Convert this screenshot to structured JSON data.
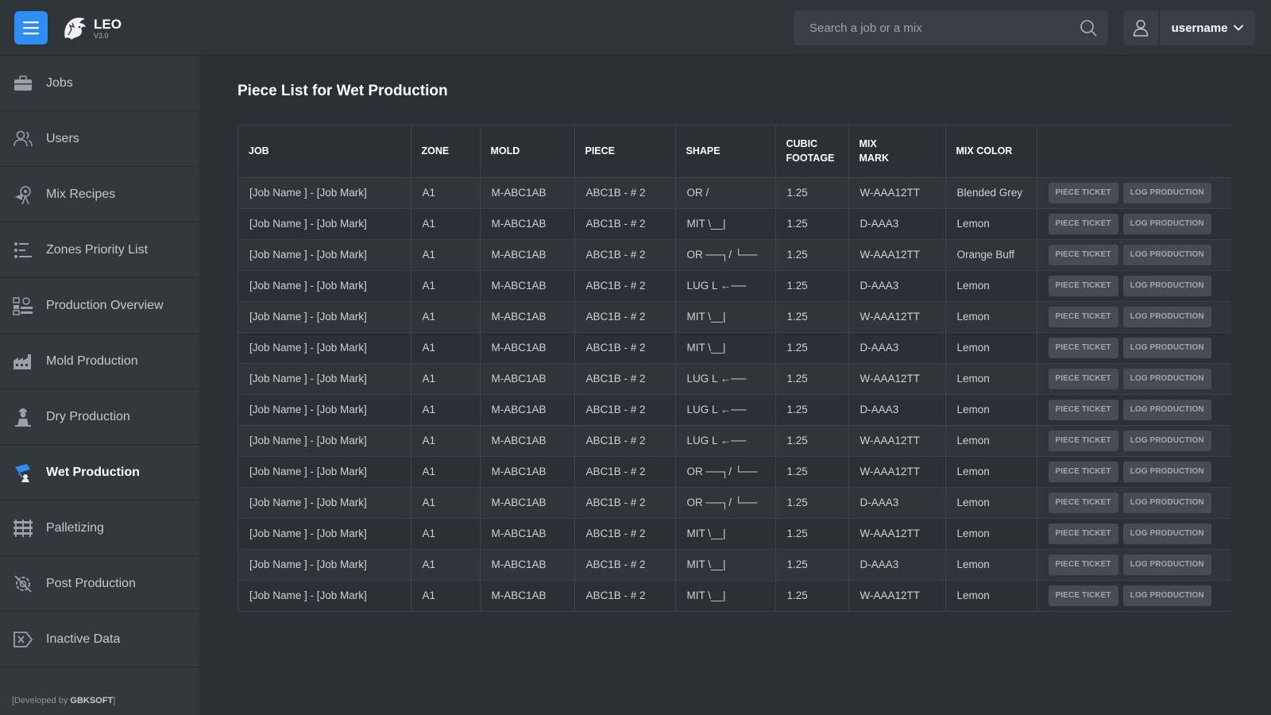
{
  "header": {
    "app_name": "LEO",
    "version": "V3.0",
    "search_placeholder": "Search a job or a mix",
    "username": "username"
  },
  "sidebar": {
    "items": [
      {
        "label": "Jobs",
        "icon": "briefcase-icon",
        "active": false
      },
      {
        "label": "Users",
        "icon": "users-icon",
        "active": false
      },
      {
        "label": "Mix Recipes",
        "icon": "mixer-icon",
        "active": false
      },
      {
        "label": "Zones Priority List",
        "icon": "priority-list-icon",
        "active": false
      },
      {
        "label": "Production Overview",
        "icon": "overview-icon",
        "active": false
      },
      {
        "label": "Mold Production",
        "icon": "factory-icon",
        "active": false
      },
      {
        "label": "Dry Production",
        "icon": "worker-icon",
        "active": false
      },
      {
        "label": "Wet Production",
        "icon": "wet-production-icon",
        "active": true
      },
      {
        "label": "Palletizing",
        "icon": "pallet-icon",
        "active": false
      },
      {
        "label": "Post Production",
        "icon": "gear-cancel-icon",
        "active": false
      },
      {
        "label": "Inactive Data",
        "icon": "inactive-icon",
        "active": false
      }
    ],
    "footer_prefix": "[Developed by ",
    "footer_brand": "GBKSOFT",
    "footer_suffix": "]"
  },
  "main": {
    "title": "Piece List for Wet Production",
    "columns": [
      "JOB",
      "ZONE",
      "MOLD",
      "PIECE",
      "SHAPE",
      "CUBIC FOOTAGE",
      "MIX MARK",
      "MIX COLOR",
      ""
    ],
    "button_piece_ticket": "PIECE TICKET",
    "button_log_production": "LOG PRODUCTION",
    "rows": [
      {
        "job": "[Job Name ] - [Job Mark]",
        "zone": "A1",
        "mold": "M-ABC1AB",
        "piece": "ABC1B - # 2",
        "shape": "OR      /",
        "cubic": "1.25",
        "mix_mark": "W-AAA12TT",
        "mix_color": "Blended Grey"
      },
      {
        "job": "[Job Name ] - [Job Mark]",
        "zone": "A1",
        "mold": "M-ABC1AB",
        "piece": "ABC1B - # 2",
        "shape": "MIT \\__|",
        "cubic": "1.25",
        "mix_mark": "D-AAA3",
        "mix_color": "Lemon"
      },
      {
        "job": "[Job Name ] - [Job Mark]",
        "zone": "A1",
        "mold": "M-ABC1AB",
        "piece": "ABC1B - # 2",
        "shape": "OR ──┐/ └──",
        "cubic": "1.25",
        "mix_mark": "W-AAA12TT",
        "mix_color": "Orange Buff"
      },
      {
        "job": "[Job Name ] - [Job Mark]",
        "zone": "A1",
        "mold": "M-ABC1AB",
        "piece": "ABC1B - # 2",
        "shape": "LUG L ←──",
        "cubic": "1.25",
        "mix_mark": "D-AAA3",
        "mix_color": "Lemon"
      },
      {
        "job": "[Job Name ] - [Job Mark]",
        "zone": "A1",
        "mold": "M-ABC1AB",
        "piece": "ABC1B - # 2",
        "shape": "MIT \\__|",
        "cubic": "1.25",
        "mix_mark": "W-AAA12TT",
        "mix_color": "Lemon"
      },
      {
        "job": "[Job Name ] - [Job Mark]",
        "zone": "A1",
        "mold": "M-ABC1AB",
        "piece": "ABC1B - # 2",
        "shape": "MIT \\__|",
        "cubic": "1.25",
        "mix_mark": "D-AAA3",
        "mix_color": "Lemon"
      },
      {
        "job": "[Job Name ] - [Job Mark]",
        "zone": "A1",
        "mold": "M-ABC1AB",
        "piece": "ABC1B - # 2",
        "shape": "LUG L ←──",
        "cubic": "1.25",
        "mix_mark": "W-AAA12TT",
        "mix_color": "Lemon"
      },
      {
        "job": "[Job Name ] - [Job Mark]",
        "zone": "A1",
        "mold": "M-ABC1AB",
        "piece": "ABC1B - # 2",
        "shape": "LUG L ←──",
        "cubic": "1.25",
        "mix_mark": "D-AAA3",
        "mix_color": "Lemon"
      },
      {
        "job": "[Job Name ] - [Job Mark]",
        "zone": "A1",
        "mold": "M-ABC1AB",
        "piece": "ABC1B - # 2",
        "shape": "LUG L ←──",
        "cubic": "1.25",
        "mix_mark": "W-AAA12TT",
        "mix_color": "Lemon"
      },
      {
        "job": "[Job Name ] - [Job Mark]",
        "zone": "A1",
        "mold": "M-ABC1AB",
        "piece": "ABC1B - # 2",
        "shape": "OR ──┐/ └──",
        "cubic": "1.25",
        "mix_mark": "W-AAA12TT",
        "mix_color": "Lemon"
      },
      {
        "job": "[Job Name ] - [Job Mark]",
        "zone": "A1",
        "mold": "M-ABC1AB",
        "piece": "ABC1B - # 2",
        "shape": "OR ──┐/ └──",
        "cubic": "1.25",
        "mix_mark": "D-AAA3",
        "mix_color": "Lemon"
      },
      {
        "job": "[Job Name ] - [Job Mark]",
        "zone": "A1",
        "mold": "M-ABC1AB",
        "piece": "ABC1B - # 2",
        "shape": "MIT \\__|",
        "cubic": "1.25",
        "mix_mark": "W-AAA12TT",
        "mix_color": "Lemon"
      },
      {
        "job": "[Job Name ] - [Job Mark]",
        "zone": "A1",
        "mold": "M-ABC1AB",
        "piece": "ABC1B - # 2",
        "shape": "MIT \\__|",
        "cubic": "1.25",
        "mix_mark": "D-AAA3",
        "mix_color": "Lemon"
      },
      {
        "job": "[Job Name ] - [Job Mark]",
        "zone": "A1",
        "mold": "M-ABC1AB",
        "piece": "ABC1B - # 2",
        "shape": "MIT \\__|",
        "cubic": "1.25",
        "mix_mark": "W-AAA12TT",
        "mix_color": "Lemon"
      }
    ]
  },
  "colors": {
    "accent": "#2f8df6",
    "background": "#2b2f36",
    "sidebar": "#33373e",
    "button": "#474c54"
  }
}
